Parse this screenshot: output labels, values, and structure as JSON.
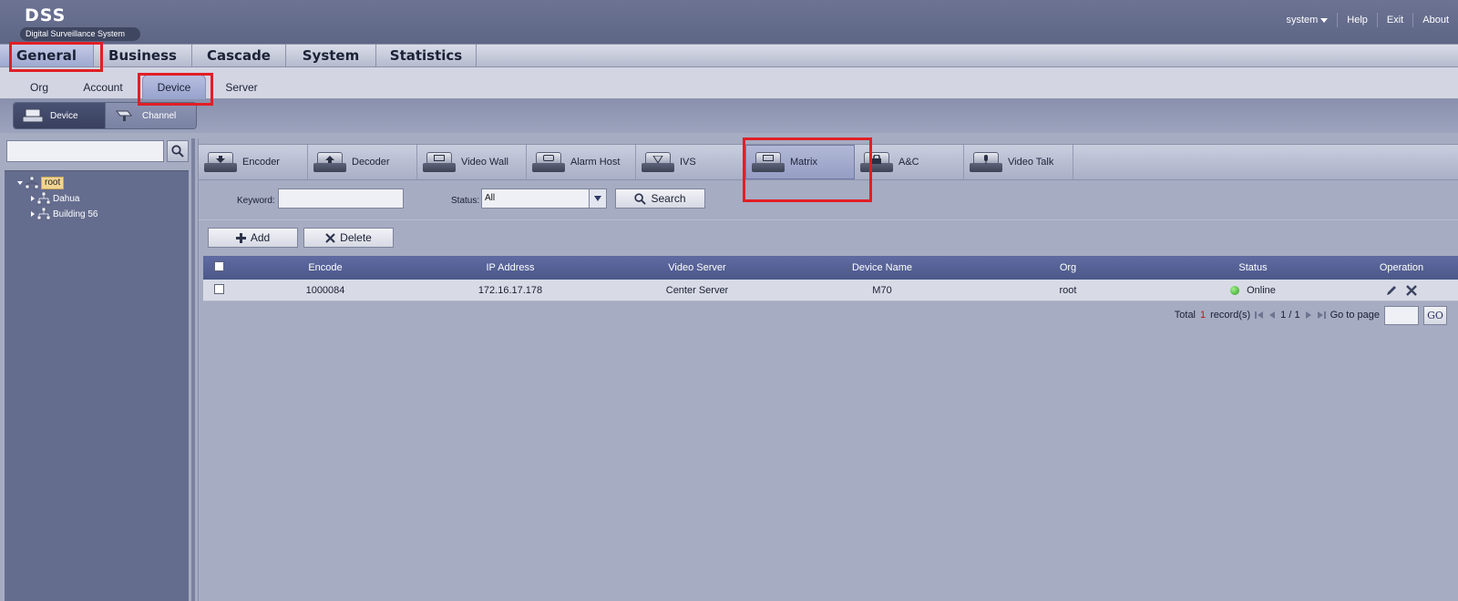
{
  "header": {
    "logo_main": "DSS",
    "logo_sub": "Digital Surveillance System",
    "user_menu": "system",
    "help": "Help",
    "exit": "Exit",
    "about": "About"
  },
  "main_nav": [
    "General",
    "Business",
    "Cascade",
    "System",
    "Statistics"
  ],
  "main_nav_active": "General",
  "sub_nav": [
    "Org",
    "Account",
    "Device",
    "Server"
  ],
  "sub_nav_active": "Device",
  "third_tabs": [
    "Device",
    "Channel"
  ],
  "third_tabs_active": "Device",
  "tree": {
    "search_placeholder": "",
    "root": "root",
    "children": [
      "Dahua",
      "Building 56"
    ]
  },
  "device_types": [
    "Encoder",
    "Decoder",
    "Video Wall",
    "Alarm Host",
    "IVS",
    "Matrix",
    "A&C",
    "Video Talk"
  ],
  "device_types_active": "Matrix",
  "filter": {
    "keyword_label": "Keyword:",
    "keyword_value": "",
    "status_label": "Status:",
    "status_value": "All",
    "search_label": "Search"
  },
  "actions": {
    "add": "Add",
    "delete": "Delete"
  },
  "table": {
    "columns": [
      "Encode",
      "IP Address",
      "Video Server",
      "Device Name",
      "Org",
      "Status",
      "Operation"
    ],
    "rows": [
      {
        "encode": "1000084",
        "ip": "172.16.17.178",
        "video_server": "Center Server",
        "device_name": "M70",
        "org": "root",
        "status": "Online"
      }
    ]
  },
  "pager": {
    "total_label": "Total",
    "total": "1",
    "records_label": "record(s)",
    "page_info": "1 / 1",
    "goto_label": "Go to page",
    "go": "GO"
  },
  "colors": {
    "annotation_red": "#e01f26",
    "online_green": "#2f9a22",
    "table_header": "#5565a0"
  }
}
